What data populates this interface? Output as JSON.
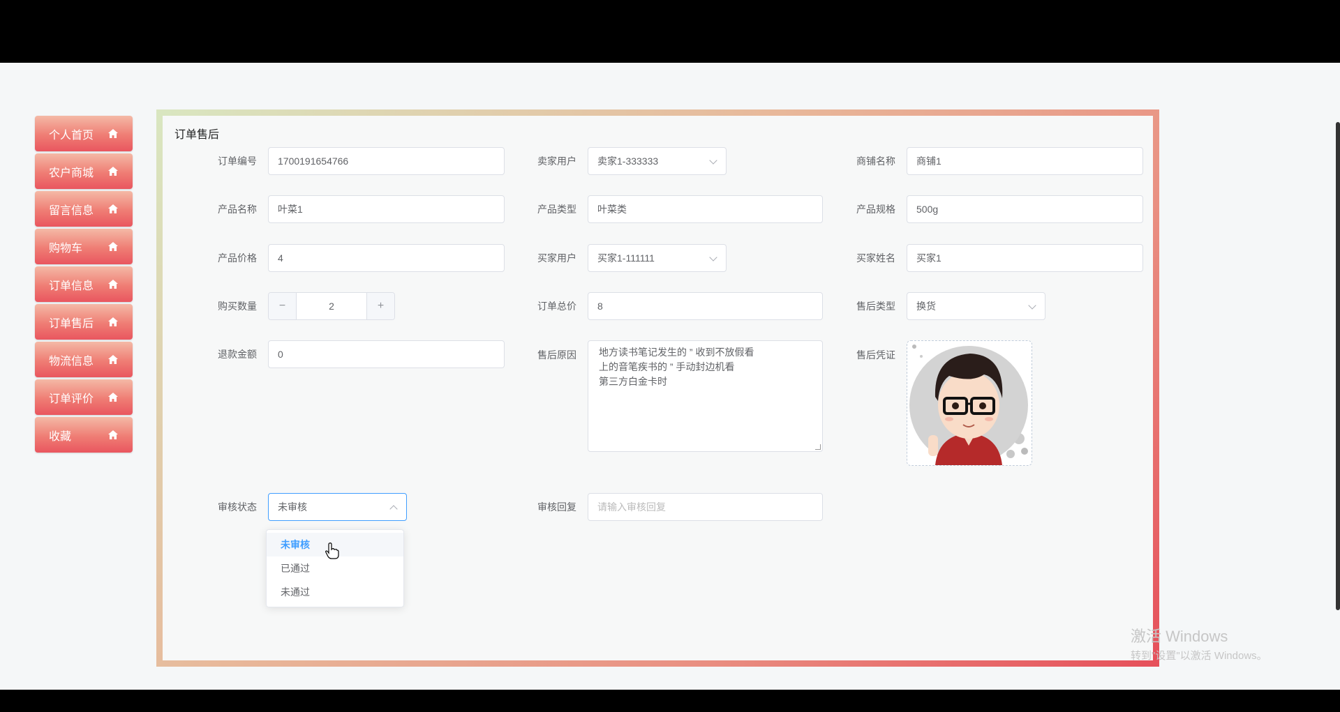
{
  "sidebar": {
    "items": [
      {
        "label": "个人首页"
      },
      {
        "label": "农户商城"
      },
      {
        "label": "留言信息"
      },
      {
        "label": "购物车"
      },
      {
        "label": "订单信息"
      },
      {
        "label": "订单售后"
      },
      {
        "label": "物流信息"
      },
      {
        "label": "订单评价"
      },
      {
        "label": "收藏"
      }
    ]
  },
  "panel": {
    "title": "订单售后"
  },
  "form": {
    "order_no": {
      "label": "订单编号",
      "value": "1700191654766"
    },
    "seller": {
      "label": "卖家用户",
      "value": "卖家1-333333"
    },
    "shop_name": {
      "label": "商铺名称",
      "value": "商铺1"
    },
    "product_name": {
      "label": "产品名称",
      "value": "叶菜1"
    },
    "product_type": {
      "label": "产品类型",
      "value": "叶菜类"
    },
    "product_spec": {
      "label": "产品规格",
      "value": "500g"
    },
    "product_price": {
      "label": "产品价格",
      "value": "4"
    },
    "buyer": {
      "label": "买家用户",
      "value": "买家1-111111"
    },
    "buyer_name": {
      "label": "买家姓名",
      "value": "买家1"
    },
    "quantity": {
      "label": "购买数量",
      "value": "2",
      "minus": "−",
      "plus": "+"
    },
    "total_price": {
      "label": "订单总价",
      "value": "8"
    },
    "after_sale_type": {
      "label": "售后类型",
      "value": "换货"
    },
    "refund_amount": {
      "label": "退款金额",
      "value": "0"
    },
    "reason": {
      "label": "售后原因",
      "value": "地方读书笔记发生的 ” 收到不放假看\n上的音笔疾书的 ” 手动封边机看\n第三方白金卡时"
    },
    "evidence": {
      "label": "售后凭证"
    },
    "review_status": {
      "label": "审核状态",
      "value": "未审核",
      "options": [
        "未审核",
        "已通过",
        "未通过"
      ]
    },
    "review_reply": {
      "label": "审核回复",
      "placeholder": "请输入审核回复"
    }
  },
  "watermark": {
    "line1": "激活 Windows",
    "line2": "转到\"设置\"以激活 Windows。"
  },
  "colors": {
    "accent": "#409eff",
    "sidebar_gradient_end": "#e9565f"
  }
}
